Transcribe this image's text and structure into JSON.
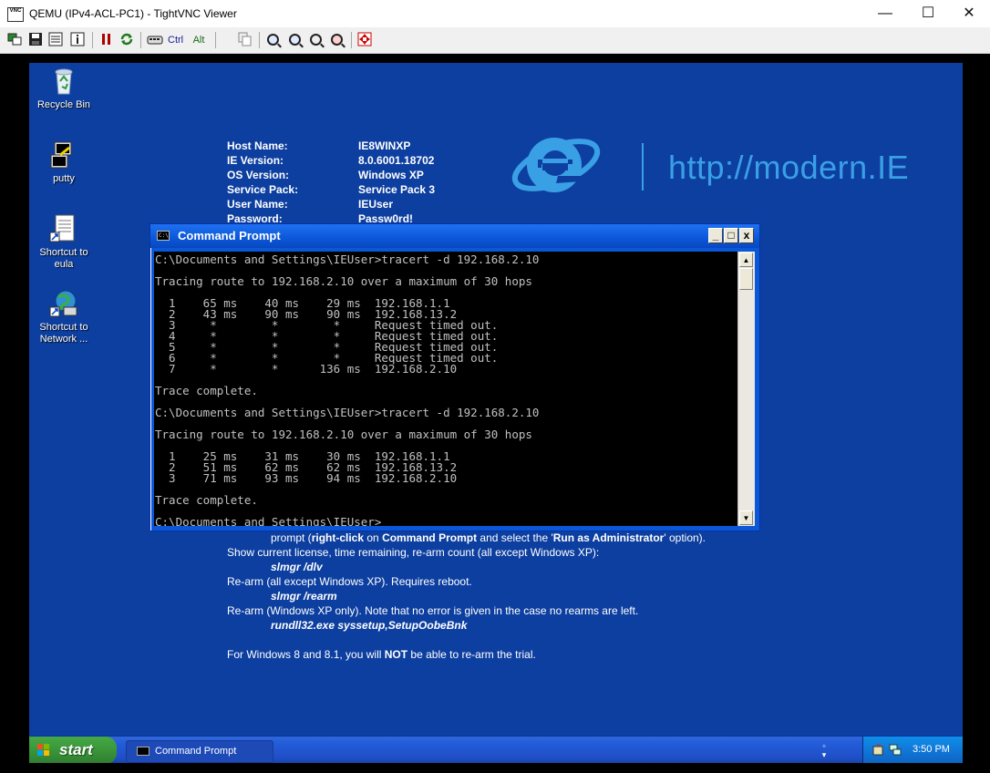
{
  "window": {
    "title": "QEMU (IPv4-ACL-PC1) - TightVNC Viewer",
    "logo_text": "VNC",
    "controls": {
      "minimize": "—",
      "maximize": "☐",
      "close": "✕"
    }
  },
  "toolbar": {
    "ctrl_label": "Ctrl",
    "alt_label": "Alt",
    "buttons": [
      "new-connection-icon",
      "save-icon",
      "options-icon",
      "info-icon",
      "pause-icon",
      "refresh-icon",
      "send-ctrl-alt-del-icon",
      "copy-icon",
      "zoom-in-icon",
      "zoom-out-icon",
      "zoom-100-icon",
      "zoom-fit-icon",
      "fullscreen-icon"
    ]
  },
  "desktop": {
    "background": "#0d3fa0",
    "icons": [
      {
        "label": "Recycle Bin",
        "icon": "recycle-bin-icon"
      },
      {
        "label": "putty",
        "icon": "putty-icon"
      },
      {
        "label": "Shortcut to eula",
        "icon": "document-icon"
      },
      {
        "label": "Shortcut to Network ...",
        "icon": "network-icon"
      }
    ],
    "info": [
      {
        "label": "Host Name:",
        "value": "IE8WINXP"
      },
      {
        "label": "IE Version:",
        "value": "8.0.6001.18702"
      },
      {
        "label": "OS Version:",
        "value": "Windows XP"
      },
      {
        "label": "Service Pack:",
        "value": "Service Pack 3"
      },
      {
        "label": "User Name:",
        "value": "IEUser"
      },
      {
        "label": "Password:",
        "value": "Passw0rd!"
      }
    ],
    "brand_url": "http://modern.IE",
    "brand_color": "#3aa0e6",
    "help": {
      "l1_a": "prompt (",
      "l1_b": "right-click",
      "l1_c": " on ",
      "l1_d": "Command Prompt",
      "l1_e": " and select the '",
      "l1_f": "Run as Administrator",
      "l1_g": "' option).",
      "l2": "Show current license, time remaining, re-arm count (all except Windows XP):",
      "l3": "slmgr /dlv",
      "l4": "Re-arm (all except Windows XP). Requires reboot.",
      "l5": "slmgr /rearm",
      "l6": "Re-arm (Windows XP only). Note that no error is given in the case no rearms are left.",
      "l7": "rundll32.exe syssetup,SetupOobeBnk",
      "l8_a": "For Windows 8 and 8.1, you will ",
      "l8_b": "NOT",
      "l8_c": " be able to re-arm the trial."
    }
  },
  "cmd": {
    "title": "Command Prompt",
    "icon_text": "C:\\",
    "buttons": {
      "minimize": "_",
      "maximize": "□",
      "close": "x"
    },
    "lines": [
      "C:\\Documents and Settings\\IEUser>tracert -d 192.168.2.10",
      "",
      "Tracing route to 192.168.2.10 over a maximum of 30 hops",
      "",
      "  1    65 ms    40 ms    29 ms  192.168.1.1",
      "  2    43 ms    90 ms    90 ms  192.168.13.2",
      "  3     *        *        *     Request timed out.",
      "  4     *        *        *     Request timed out.",
      "  5     *        *        *     Request timed out.",
      "  6     *        *        *     Request timed out.",
      "  7     *        *      136 ms  192.168.2.10",
      "",
      "Trace complete.",
      "",
      "C:\\Documents and Settings\\IEUser>tracert -d 192.168.2.10",
      "",
      "Tracing route to 192.168.2.10 over a maximum of 30 hops",
      "",
      "  1    25 ms    31 ms    30 ms  192.168.1.1",
      "  2    51 ms    62 ms    62 ms  192.168.13.2",
      "  3    71 ms    93 ms    94 ms  192.168.2.10",
      "",
      "Trace complete.",
      "",
      "C:\\Documents and Settings\\IEUser>"
    ]
  },
  "taskbar": {
    "start_label": "start",
    "task_item": "Command Prompt",
    "clock": "3:50 PM",
    "tray_icons": [
      "tray-app-icon",
      "network-tray-icon"
    ]
  }
}
